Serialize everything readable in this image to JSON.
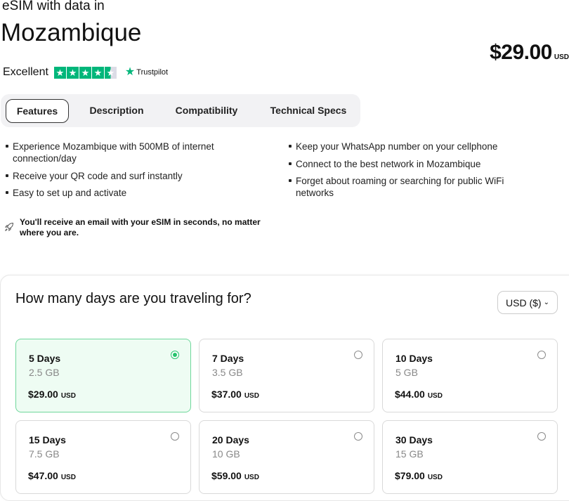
{
  "header": {
    "subtitle": "eSIM with data in",
    "title": "Mozambique",
    "price": "$29.00",
    "currency": "USD"
  },
  "rating": {
    "label": "Excellent",
    "brand": "Trustpilot",
    "stars": 4.5,
    "star_color": "#00b67a"
  },
  "tabs": [
    {
      "label": "Features"
    },
    {
      "label": "Description"
    },
    {
      "label": "Compatibility"
    },
    {
      "label": "Technical Specs"
    }
  ],
  "features": {
    "left": [
      "Experience Mozambique with 500MB of internet connection/day",
      "Receive your QR code and surf instantly",
      "Easy to set up and activate"
    ],
    "right": [
      "Keep your WhatsApp number on your cellphone",
      "Connect to the best network in Mozambique",
      "Forget about roaming or searching for public WiFi networks"
    ]
  },
  "note": {
    "icon": "rocket-icon",
    "text": "You'll receive an email with your eSIM in seconds, no matter where you are."
  },
  "plans": {
    "question": "How many days are you traveling for?",
    "currency_select": "USD ($)",
    "accent": "#27c46d",
    "options": [
      {
        "days": "5 Days",
        "data": "2.5 GB",
        "price": "$29.00",
        "currency": "USD",
        "selected": true
      },
      {
        "days": "7 Days",
        "data": "3.5 GB",
        "price": "$37.00",
        "currency": "USD",
        "selected": false
      },
      {
        "days": "10 Days",
        "data": "5 GB",
        "price": "$44.00",
        "currency": "USD",
        "selected": false
      },
      {
        "days": "15 Days",
        "data": "7.5 GB",
        "price": "$47.00",
        "currency": "USD",
        "selected": false
      },
      {
        "days": "20 Days",
        "data": "10 GB",
        "price": "$59.00",
        "currency": "USD",
        "selected": false
      },
      {
        "days": "30 Days",
        "data": "15 GB",
        "price": "$79.00",
        "currency": "USD",
        "selected": false
      }
    ]
  }
}
